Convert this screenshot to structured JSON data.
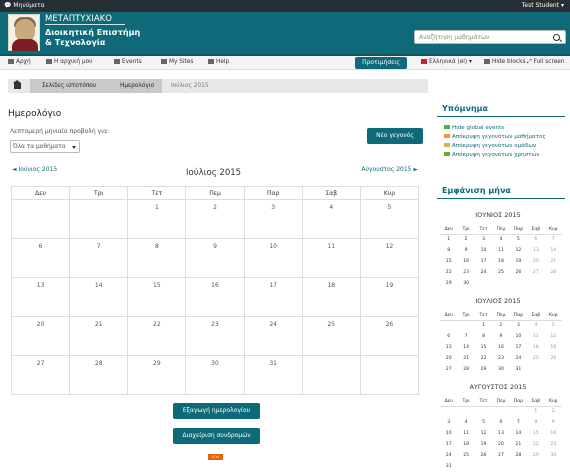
{
  "topbar": {
    "messages": "Μηνύματα",
    "user": "Test Student"
  },
  "header": {
    "brand_line1": "ΜΕΤΑΠΤΥΧΙΑΚΟ",
    "brand_line2": "Διοικητική Επιστήμη",
    "brand_line3": "& Τεχνολογία",
    "search_placeholder": "Αναζήτηση μαθημάτων"
  },
  "navbar": {
    "items": [
      "Αρχή",
      "Η αρχική μου",
      "Events",
      "My Sites",
      "Help"
    ],
    "preferences": "Προτιμήσεις",
    "language": "Ελληνικά (el)",
    "hide_blocks": "Hide blocks",
    "full_screen": "Full screen"
  },
  "breadcrumb": [
    "Σελίδες ιστοτόπου",
    "Ημερολόγιο",
    "Ιούλιος 2015"
  ],
  "main": {
    "title": "Ημερολόγιο",
    "filter_label": "Λεπτομερή μηνιαία προβολή για:",
    "filter_value": "Όλα τα μαθήματα",
    "new_event": "Νέο γεγονός",
    "prev_month": "◄ Ιούνιος 2015",
    "next_month": "Αύγουστος 2015 ►",
    "month_title": "Ιούλιος 2015",
    "weekdays": [
      "Δευ",
      "Τρι",
      "Τετ",
      "Πεμ",
      "Παρ",
      "Σαβ",
      "Κυρ"
    ],
    "weeks": [
      [
        "",
        "",
        "1",
        "2",
        "3",
        "4",
        "5"
      ],
      [
        "6",
        "7",
        "8",
        "9",
        "10",
        "11",
        "12"
      ],
      [
        "13",
        "14",
        "15",
        "16",
        "17",
        "18",
        "19"
      ],
      [
        "20",
        "21",
        "22",
        "23",
        "24",
        "25",
        "26"
      ],
      [
        "27",
        "28",
        "29",
        "30",
        "31",
        "",
        ""
      ]
    ],
    "export_button": "Εξαγωγή ημερολογίου",
    "subscriptions_button": "Διαχείριση συνδρομών",
    "ical": "iCal"
  },
  "legend": {
    "title": "Υπόμνημα",
    "items": [
      {
        "label": "Hide global events",
        "color": "#4caf50"
      },
      {
        "label": "Απόκρυψη γεγονότων μαθήματος",
        "color": "#e0a030"
      },
      {
        "label": "Απόκρυψη γεγονότων ομάδων",
        "color": "#d9b34a"
      },
      {
        "label": "Απόκρυψη γεγονότων χρηστών",
        "color": "#6aaa3a"
      }
    ]
  },
  "month_block": {
    "title": "Εμφάνιση μήνα",
    "weekdays": [
      "Δευ",
      "Τρι",
      "Τετ",
      "Πεμ",
      "Παρ",
      "Σαβ",
      "Κυρ"
    ],
    "months": [
      {
        "name": "ΙΟΥΝΙΟΣ 2015",
        "weeks": [
          [
            "1",
            "2",
            "3",
            "4",
            "5",
            "6",
            "7"
          ],
          [
            "8",
            "9",
            "10",
            "11",
            "12",
            "13",
            "14"
          ],
          [
            "15",
            "16",
            "17",
            "18",
            "19",
            "20",
            "21"
          ],
          [
            "22",
            "23",
            "24",
            "25",
            "26",
            "27",
            "28"
          ],
          [
            "29",
            "30",
            "",
            "",
            "",
            "",
            ""
          ]
        ]
      },
      {
        "name": "ΙΟΥΛΙΟΣ 2015",
        "weeks": [
          [
            "",
            "",
            "1",
            "2",
            "3",
            "4",
            "5"
          ],
          [
            "6",
            "7",
            "8",
            "9",
            "10",
            "11",
            "12"
          ],
          [
            "13",
            "14",
            "15",
            "16",
            "17",
            "18",
            "19"
          ],
          [
            "20",
            "21",
            "22",
            "23",
            "24",
            "25",
            "26"
          ],
          [
            "27",
            "28",
            "29",
            "30",
            "31",
            "",
            ""
          ]
        ]
      },
      {
        "name": "ΑΥΓΟΥΣΤΟΣ 2015",
        "weeks": [
          [
            "",
            "",
            "",
            "",
            "",
            "1",
            "2"
          ],
          [
            "3",
            "4",
            "5",
            "6",
            "7",
            "8",
            "9"
          ],
          [
            "10",
            "11",
            "12",
            "13",
            "14",
            "15",
            "16"
          ],
          [
            "17",
            "18",
            "19",
            "20",
            "21",
            "22",
            "23"
          ],
          [
            "24",
            "25",
            "26",
            "27",
            "28",
            "29",
            "30"
          ],
          [
            "31",
            "",
            "",
            "",
            "",
            "",
            ""
          ]
        ]
      }
    ]
  },
  "colors": {
    "brand": "#0e6a78",
    "topbar": "#262f33"
  }
}
